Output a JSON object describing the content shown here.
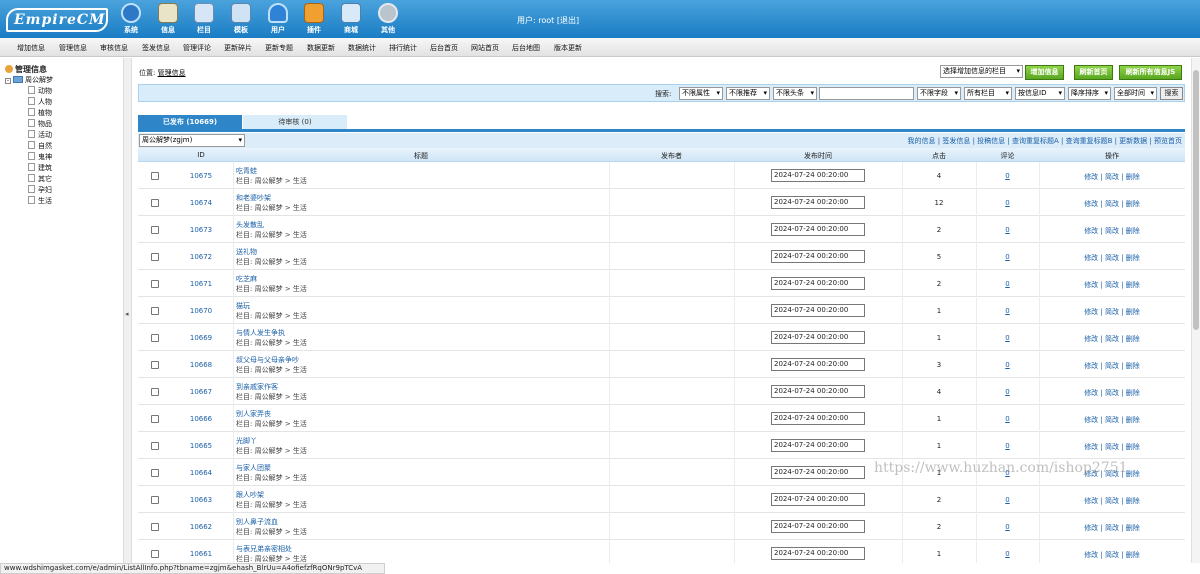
{
  "app": {
    "logo": "EmpireCMS",
    "user_label": "用户: root",
    "logout": "[退出]"
  },
  "top_nav": [
    {
      "label": "系统",
      "icon": "globe-icon",
      "color": "#2d79c8"
    },
    {
      "label": "信息",
      "icon": "document-edit-icon",
      "color": "#e9e3c8"
    },
    {
      "label": "栏目",
      "icon": "folder-icon",
      "color": "#d7e6f7"
    },
    {
      "label": "模板",
      "icon": "template-icon",
      "color": "#cfe3f5"
    },
    {
      "label": "用户",
      "icon": "user-icon",
      "color": "#2f83d6"
    },
    {
      "label": "插件",
      "icon": "tools-icon",
      "color": "#f0a030"
    },
    {
      "label": "商城",
      "icon": "shop-icon",
      "color": "#d8e9f7"
    },
    {
      "label": "其他",
      "icon": "gear-icon",
      "color": "#b9c4cc"
    }
  ],
  "menu": [
    "增加信息",
    "管理信息",
    "审核信息",
    "签发信息",
    "管理评论",
    "更新碎片",
    "更新专题",
    "数据更新",
    "数据统计",
    "排行统计",
    "后台首页",
    "网站首页",
    "后台地图",
    "版本更新"
  ],
  "sidebar": {
    "root": "管理信息",
    "category": "周公解梦",
    "items": [
      "动物",
      "人物",
      "植物",
      "物品",
      "活动",
      "自然",
      "鬼神",
      "建筑",
      "其它",
      "孕妇",
      "生活"
    ]
  },
  "location": {
    "label": "位置:",
    "link": "管理信息"
  },
  "actions": {
    "select_column": "选择增加信息的栏目",
    "add": "增加信息",
    "refresh_home": "刷新首页",
    "refresh_js": "刷新所有信息JS"
  },
  "search": {
    "label": "搜索:",
    "attr": "不限属性",
    "recommend": "不限推荐",
    "headline": "不限头条",
    "keyword": "",
    "field": "不限字段",
    "column": "所有栏目",
    "by_id": "按信息ID",
    "order": "降序排序",
    "time": "全部时间",
    "button": "搜索"
  },
  "tabs": {
    "published": "已发布 (10669)",
    "pending": "待审核 (0)"
  },
  "table_filter": "周公解梦(zgjm)",
  "filter_links": "我的信息 | 签发信息 | 投稿信息 | 查询重复标题A | 查询重复标题B | 更新数据 | 预览首页",
  "table": {
    "headers": {
      "id": "ID",
      "title": "标题",
      "publisher": "发布者",
      "time": "发布时间",
      "clicks": "点击",
      "comments": "评论",
      "ops": "操作"
    },
    "ops_label": "修改 | 简改 | 删除",
    "rows": [
      {
        "id": "10675",
        "title": "吃青蛙",
        "path": "栏目: 周公解梦 > 生活",
        "time": "2024-07-24 00:20:00",
        "clicks": "4",
        "comments": "0"
      },
      {
        "id": "10674",
        "title": "和老婆吵架",
        "path": "栏目: 周公解梦 > 生活",
        "time": "2024-07-24 00:20:00",
        "clicks": "12",
        "comments": "0"
      },
      {
        "id": "10673",
        "title": "头发散乱",
        "path": "栏目: 周公解梦 > 生活",
        "time": "2024-07-24 00:20:00",
        "clicks": "2",
        "comments": "0"
      },
      {
        "id": "10672",
        "title": "送礼物",
        "path": "栏目: 周公解梦 > 生活",
        "time": "2024-07-24 00:20:00",
        "clicks": "5",
        "comments": "0"
      },
      {
        "id": "10671",
        "title": "吃芝麻",
        "path": "栏目: 周公解梦 > 生活",
        "time": "2024-07-24 00:20:00",
        "clicks": "2",
        "comments": "0"
      },
      {
        "id": "10670",
        "title": "猫玩",
        "path": "栏目: 周公解梦 > 生活",
        "time": "2024-07-24 00:20:00",
        "clicks": "1",
        "comments": "0"
      },
      {
        "id": "10669",
        "title": "与情人发生争执",
        "path": "栏目: 周公解梦 > 生活",
        "time": "2024-07-24 00:20:00",
        "clicks": "1",
        "comments": "0"
      },
      {
        "id": "10668",
        "title": "叔父母与父母亲争吵",
        "path": "栏目: 周公解梦 > 生活",
        "time": "2024-07-24 00:20:00",
        "clicks": "3",
        "comments": "0"
      },
      {
        "id": "10667",
        "title": "到亲戚家作客",
        "path": "栏目: 周公解梦 > 生活",
        "time": "2024-07-24 00:20:00",
        "clicks": "4",
        "comments": "0"
      },
      {
        "id": "10666",
        "title": "别人家弄丧",
        "path": "栏目: 周公解梦 > 生活",
        "time": "2024-07-24 00:20:00",
        "clicks": "1",
        "comments": "0"
      },
      {
        "id": "10665",
        "title": "光脚丫",
        "path": "栏目: 周公解梦 > 生活",
        "time": "2024-07-24 00:20:00",
        "clicks": "1",
        "comments": "0"
      },
      {
        "id": "10664",
        "title": "与家人团聚",
        "path": "栏目: 周公解梦 > 生活",
        "time": "2024-07-24 00:20:00",
        "clicks": "1",
        "comments": "0"
      },
      {
        "id": "10663",
        "title": "跟人吵架",
        "path": "栏目: 周公解梦 > 生活",
        "time": "2024-07-24 00:20:00",
        "clicks": "2",
        "comments": "0"
      },
      {
        "id": "10662",
        "title": "别人鼻子流血",
        "path": "栏目: 周公解梦 > 生活",
        "time": "2024-07-24 00:20:00",
        "clicks": "2",
        "comments": "0"
      },
      {
        "id": "10661",
        "title": "与表兄弟亲密相处",
        "path": "栏目: 周公解梦 > 生活",
        "time": "2024-07-24 00:20:00",
        "clicks": "1",
        "comments": "0"
      }
    ]
  },
  "status_url": "www.wdshimgasket.com/e/admin/ListAllInfo.php?tbname=zgjm&ehash_BlrUu=A4ofiefzfRqONr9pTCvA",
  "watermark": "https://www.huzhan.com/ishop2751"
}
